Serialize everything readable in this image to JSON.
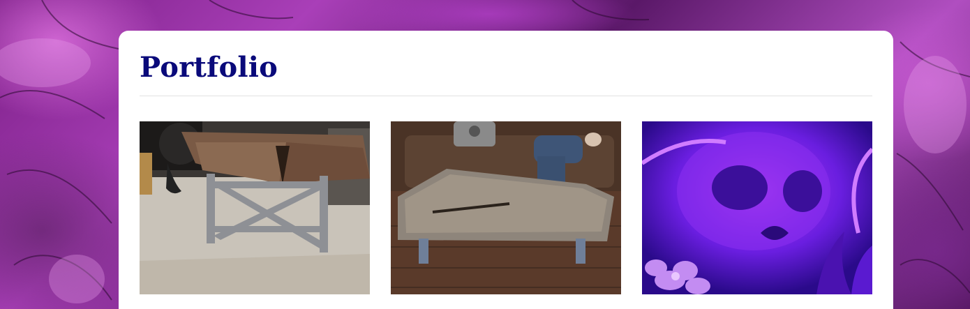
{
  "page": {
    "title": "Portfolio"
  },
  "colors": {
    "title": "#0a0a7a",
    "background_accent": "#a93fb8",
    "card": "#ffffff",
    "divider": "#e2e2e2"
  },
  "gallery": {
    "items": [
      {
        "icon": "photo-live-edge-table-steel-x-base"
      },
      {
        "icon": "photo-walnut-coffee-table-living-room"
      },
      {
        "icon": "photo-purple-skull-mural-art"
      }
    ]
  }
}
